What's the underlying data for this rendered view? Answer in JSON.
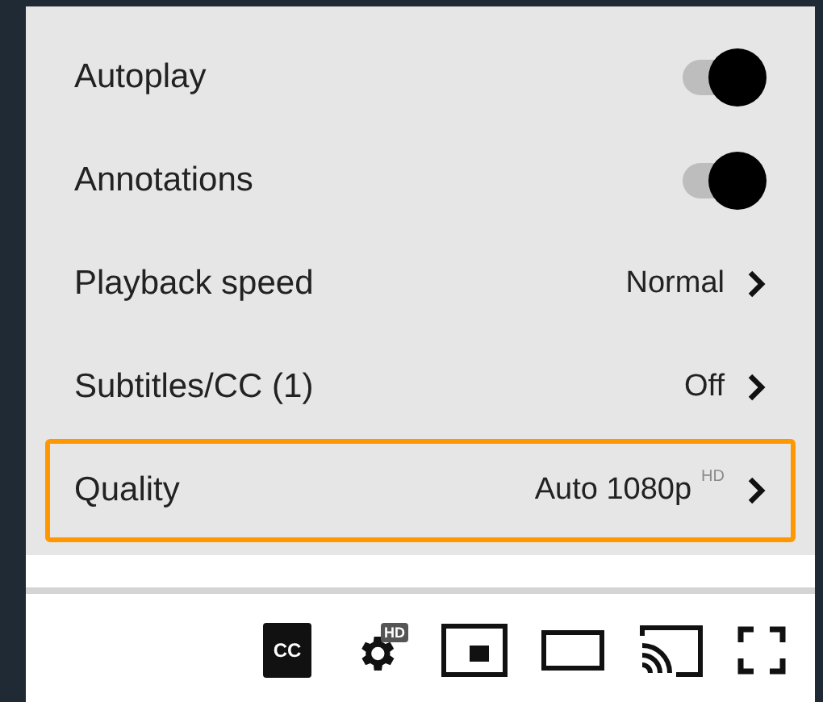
{
  "settings_menu": {
    "items": [
      {
        "kind": "toggle",
        "label": "Autoplay",
        "on": true,
        "highlighted": false
      },
      {
        "kind": "toggle",
        "label": "Annotations",
        "on": true,
        "highlighted": false
      },
      {
        "kind": "submenu",
        "label": "Playback speed",
        "value": "Normal",
        "highlighted": false
      },
      {
        "kind": "submenu",
        "label": "Subtitles/CC (1)",
        "value": "Off",
        "highlighted": false
      },
      {
        "kind": "submenu",
        "label": "Quality",
        "value": "Auto 1080p",
        "badge": "HD",
        "highlighted": true
      }
    ]
  },
  "player_controls": [
    {
      "kind": "cc",
      "label": "CC"
    },
    {
      "kind": "settings",
      "label": "HD"
    },
    {
      "kind": "miniplayer"
    },
    {
      "kind": "theater"
    },
    {
      "kind": "cast"
    },
    {
      "kind": "fullscreen"
    }
  ]
}
